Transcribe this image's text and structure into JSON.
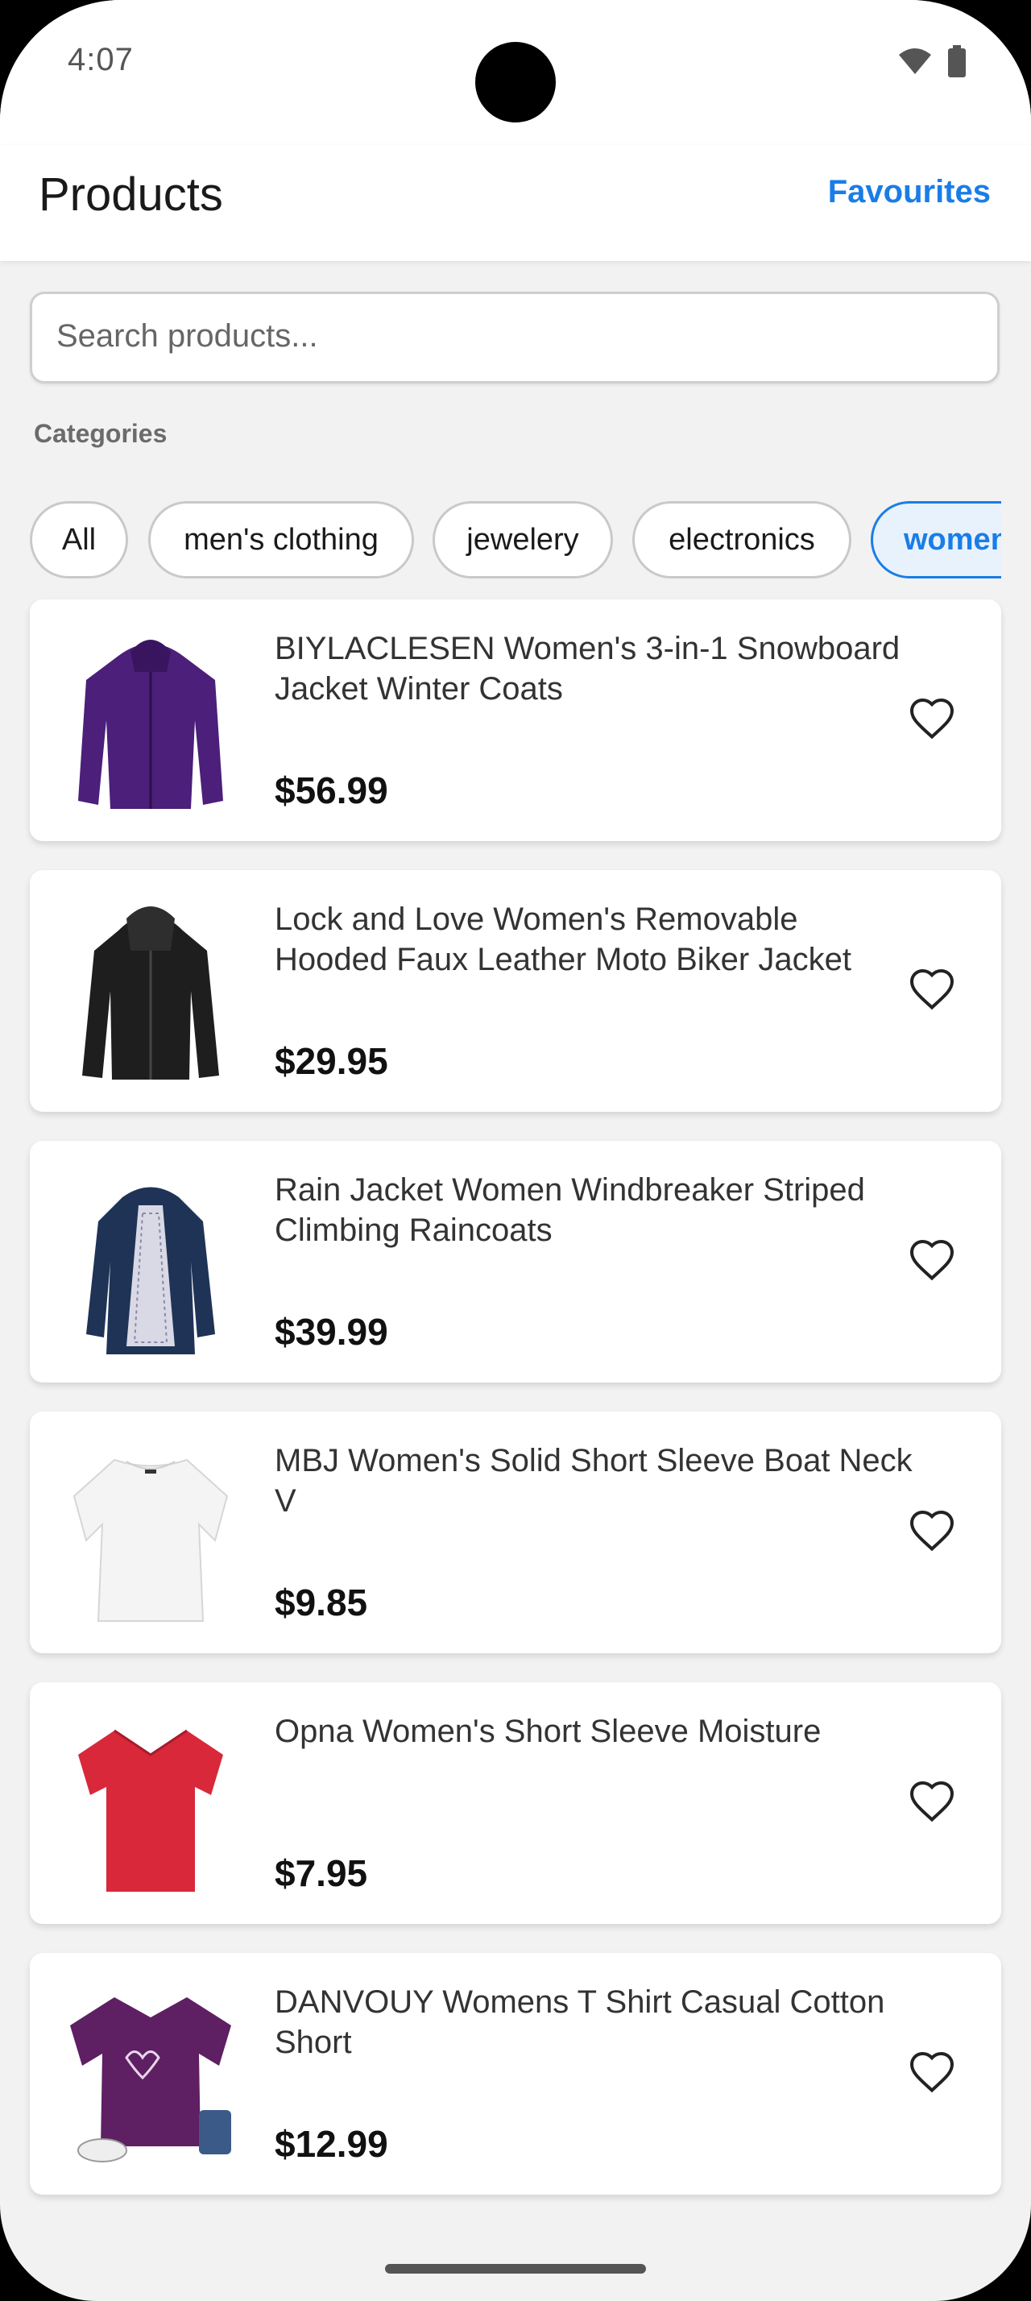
{
  "status": {
    "time": "4:07"
  },
  "header": {
    "title": "Products",
    "favourites_label": "Favourites"
  },
  "search": {
    "placeholder": "Search products..."
  },
  "categories": {
    "label": "Categories",
    "items": [
      "All",
      "men's clothing",
      "jewelery",
      "electronics",
      "women's clothing"
    ],
    "selected": "women's clothing"
  },
  "products": [
    {
      "title": "BIYLACLESEN Women's 3-in-1 Snowboard Jacket Winter Coats",
      "price": "$56.99",
      "image": "purple-jacket",
      "color": "#4b1f7a"
    },
    {
      "title": "Lock and Love Women's Removable Hooded Faux Leather Moto Biker Jacket",
      "price": "$29.95",
      "image": "black-leather-jacket",
      "color": "#1e1e1e"
    },
    {
      "title": "Rain Jacket Women Windbreaker Striped Climbing Raincoats",
      "price": "$39.99",
      "image": "navy-raincoat",
      "color": "#1f3356"
    },
    {
      "title": "MBJ Women's Solid Short Sleeve Boat Neck V",
      "price": "$9.85",
      "image": "white-tshirt",
      "color": "#f4f4f4"
    },
    {
      "title": "Opna Women's Short Sleeve Moisture",
      "price": "$7.95",
      "image": "red-tshirt",
      "color": "#d8283a"
    },
    {
      "title": "DANVOUY Womens T Shirt Casual Cotton Short",
      "price": "$12.99",
      "image": "purple-tshirt",
      "color": "#5e1f63"
    }
  ],
  "colors": {
    "accent": "#1a7de6",
    "background": "#f2f2f2"
  }
}
